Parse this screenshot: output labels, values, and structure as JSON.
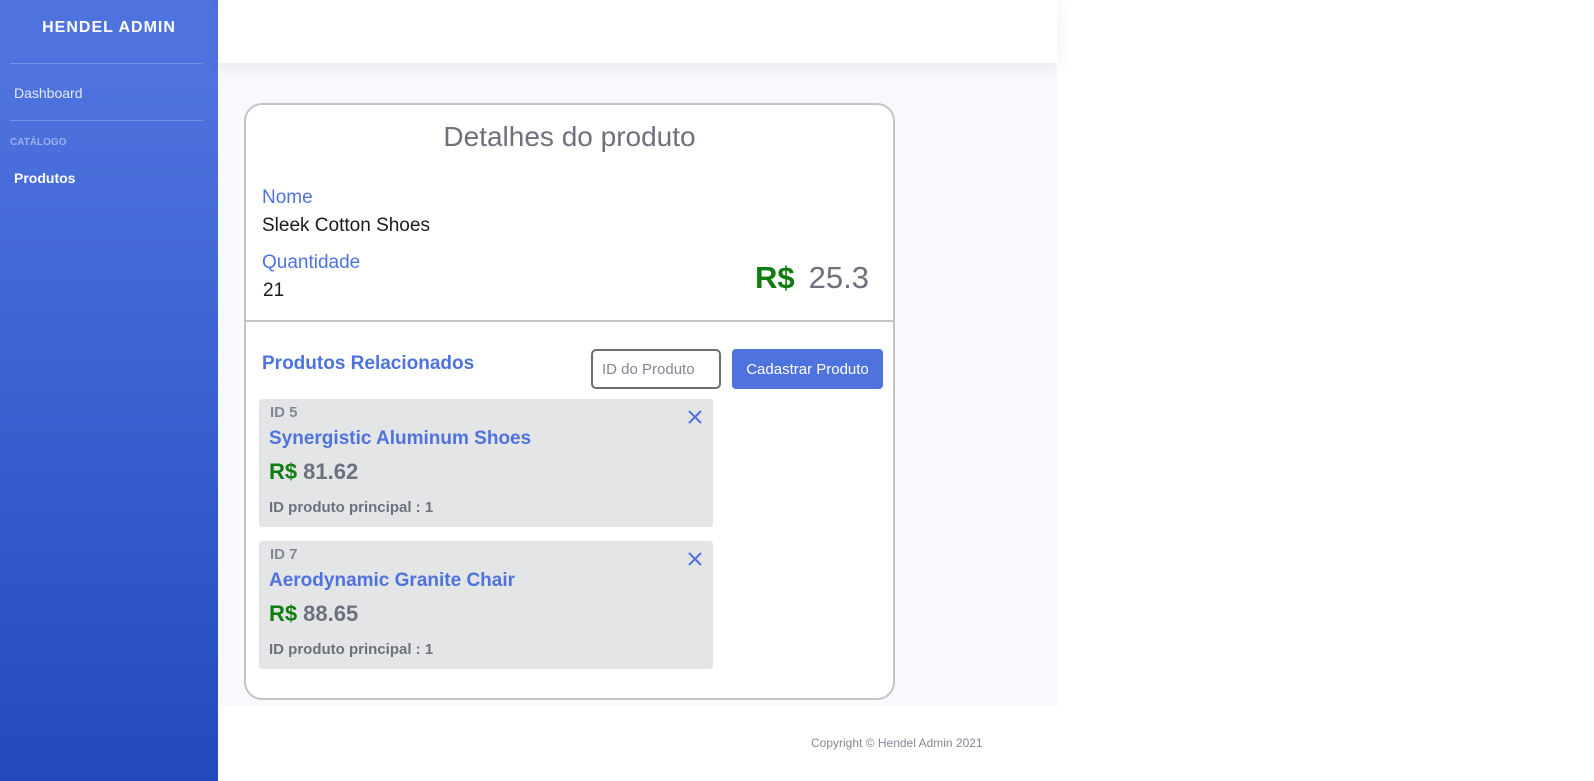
{
  "sidebar": {
    "brand": "HENDEL ADMIN",
    "dashboard_label": "Dashboard",
    "section_heading": "CATÁLOGO",
    "products_label": "Produtos"
  },
  "product": {
    "title": "Detalhes do produto",
    "name_label": "Nome",
    "name_value": "Sleek Cotton Shoes",
    "quantity_label": "Quantidade",
    "quantity_value": "21",
    "currency": "R$",
    "price": "25.3"
  },
  "related": {
    "title": "Produtos Relacionados",
    "input_placeholder": "ID do Produto",
    "input_value": "",
    "add_button_label": "Cadastrar Produto",
    "items": [
      {
        "id_label": "ID 5",
        "name": "Synergistic Aluminum Shoes",
        "currency": "R$",
        "price": "81.62",
        "parent_label": "ID produto principal : 1"
      },
      {
        "id_label": "ID 7",
        "name": "Aerodynamic Granite Chair",
        "currency": "R$",
        "price": "88.65",
        "parent_label": "ID produto principal : 1"
      }
    ]
  },
  "footer": {
    "copyright": "Copyright © Hendel Admin 2021"
  },
  "colors": {
    "primary": "#4e73df",
    "currency_green": "#0f7d0f",
    "muted_gray": "#6e707e"
  }
}
